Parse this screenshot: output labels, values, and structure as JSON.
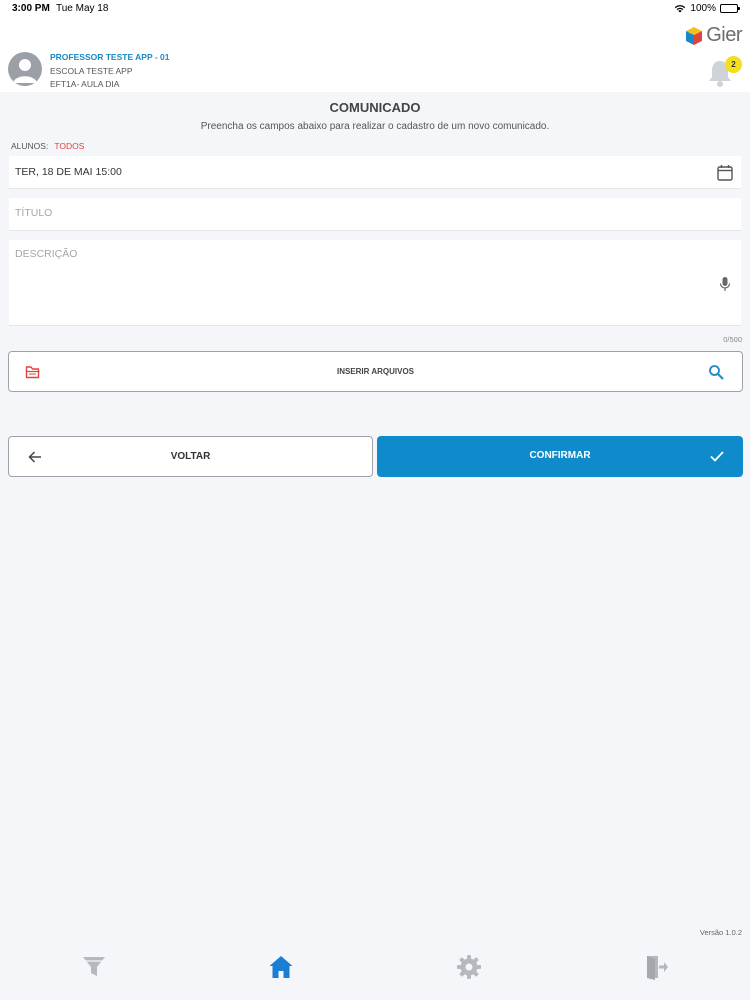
{
  "status_bar": {
    "time": "3:00 PM",
    "date": "Tue May 18",
    "battery_text": "100%",
    "battery_level": 1.0
  },
  "header": {
    "user_name": "PROFESSOR TESTE APP - 01",
    "school": "ESCOLA TESTE APP",
    "class_name": "EFT1A- AULA DIA",
    "logo_text": "Gier",
    "notification_count": "2"
  },
  "form": {
    "title": "COMUNICADO",
    "subtitle": "Preencha os campos abaixo para realizar o cadastro de um novo comunicado.",
    "students_label": "ALUNOS:",
    "students_value": "TODOS",
    "date_value": "TER, 18 DE MAI 15:00",
    "title_placeholder": "TÍTULO",
    "description_placeholder": "DESCRIÇÃO",
    "char_counter": "0/500",
    "attach_label": "INSERIR ARQUIVOS"
  },
  "actions": {
    "back_label": "VOLTAR",
    "confirm_label": "CONFIRMAR"
  },
  "footer": {
    "version": "Versão 1.0.2"
  },
  "tabs": [
    {
      "icon": "filter-icon",
      "active": false
    },
    {
      "icon": "home-icon",
      "active": true
    },
    {
      "icon": "gear-icon",
      "active": false
    },
    {
      "icon": "logout-icon",
      "active": false
    }
  ],
  "colors": {
    "accent": "#0f8bcc",
    "link": "#1a8ac6",
    "danger": "#e0443e",
    "badge": "#f3de22",
    "inactive_icon": "#b5b8bd"
  }
}
